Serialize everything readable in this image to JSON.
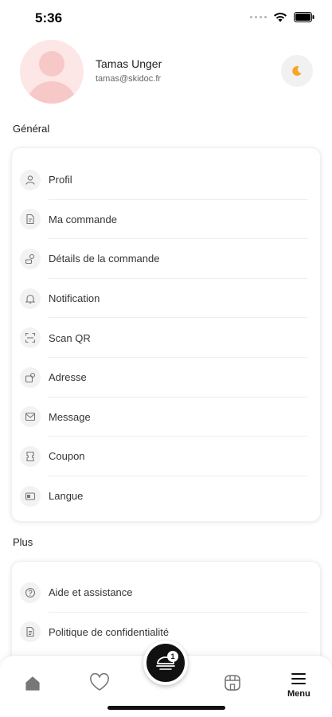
{
  "status_bar": {
    "time": "5:36"
  },
  "user": {
    "name": "Tamas Unger",
    "email": "tamas@skidoc.fr"
  },
  "sections": {
    "general": {
      "title": "Général",
      "items": [
        {
          "label": "Profil",
          "icon": "user-icon"
        },
        {
          "label": "Ma commande",
          "icon": "order-icon"
        },
        {
          "label": "Détails de la commande",
          "icon": "order-details-icon"
        },
        {
          "label": "Notification",
          "icon": "bell-icon"
        },
        {
          "label": "Scan QR",
          "icon": "qr-scan-icon"
        },
        {
          "label": "Adresse",
          "icon": "address-icon"
        },
        {
          "label": "Message",
          "icon": "message-icon"
        },
        {
          "label": "Coupon",
          "icon": "coupon-icon"
        },
        {
          "label": "Langue",
          "icon": "language-icon"
        }
      ]
    },
    "plus": {
      "title": "Plus",
      "items": [
        {
          "label": "Aide et assistance",
          "icon": "help-icon"
        },
        {
          "label": "Politique de confidentialité",
          "icon": "document-icon"
        }
      ]
    }
  },
  "bottom_nav": {
    "menu_label": "Menu",
    "cart_count": "1"
  },
  "colors": {
    "avatar_bg": "#fde6e6",
    "theme_icon": "#f5a623",
    "accent_dark": "#111111"
  }
}
